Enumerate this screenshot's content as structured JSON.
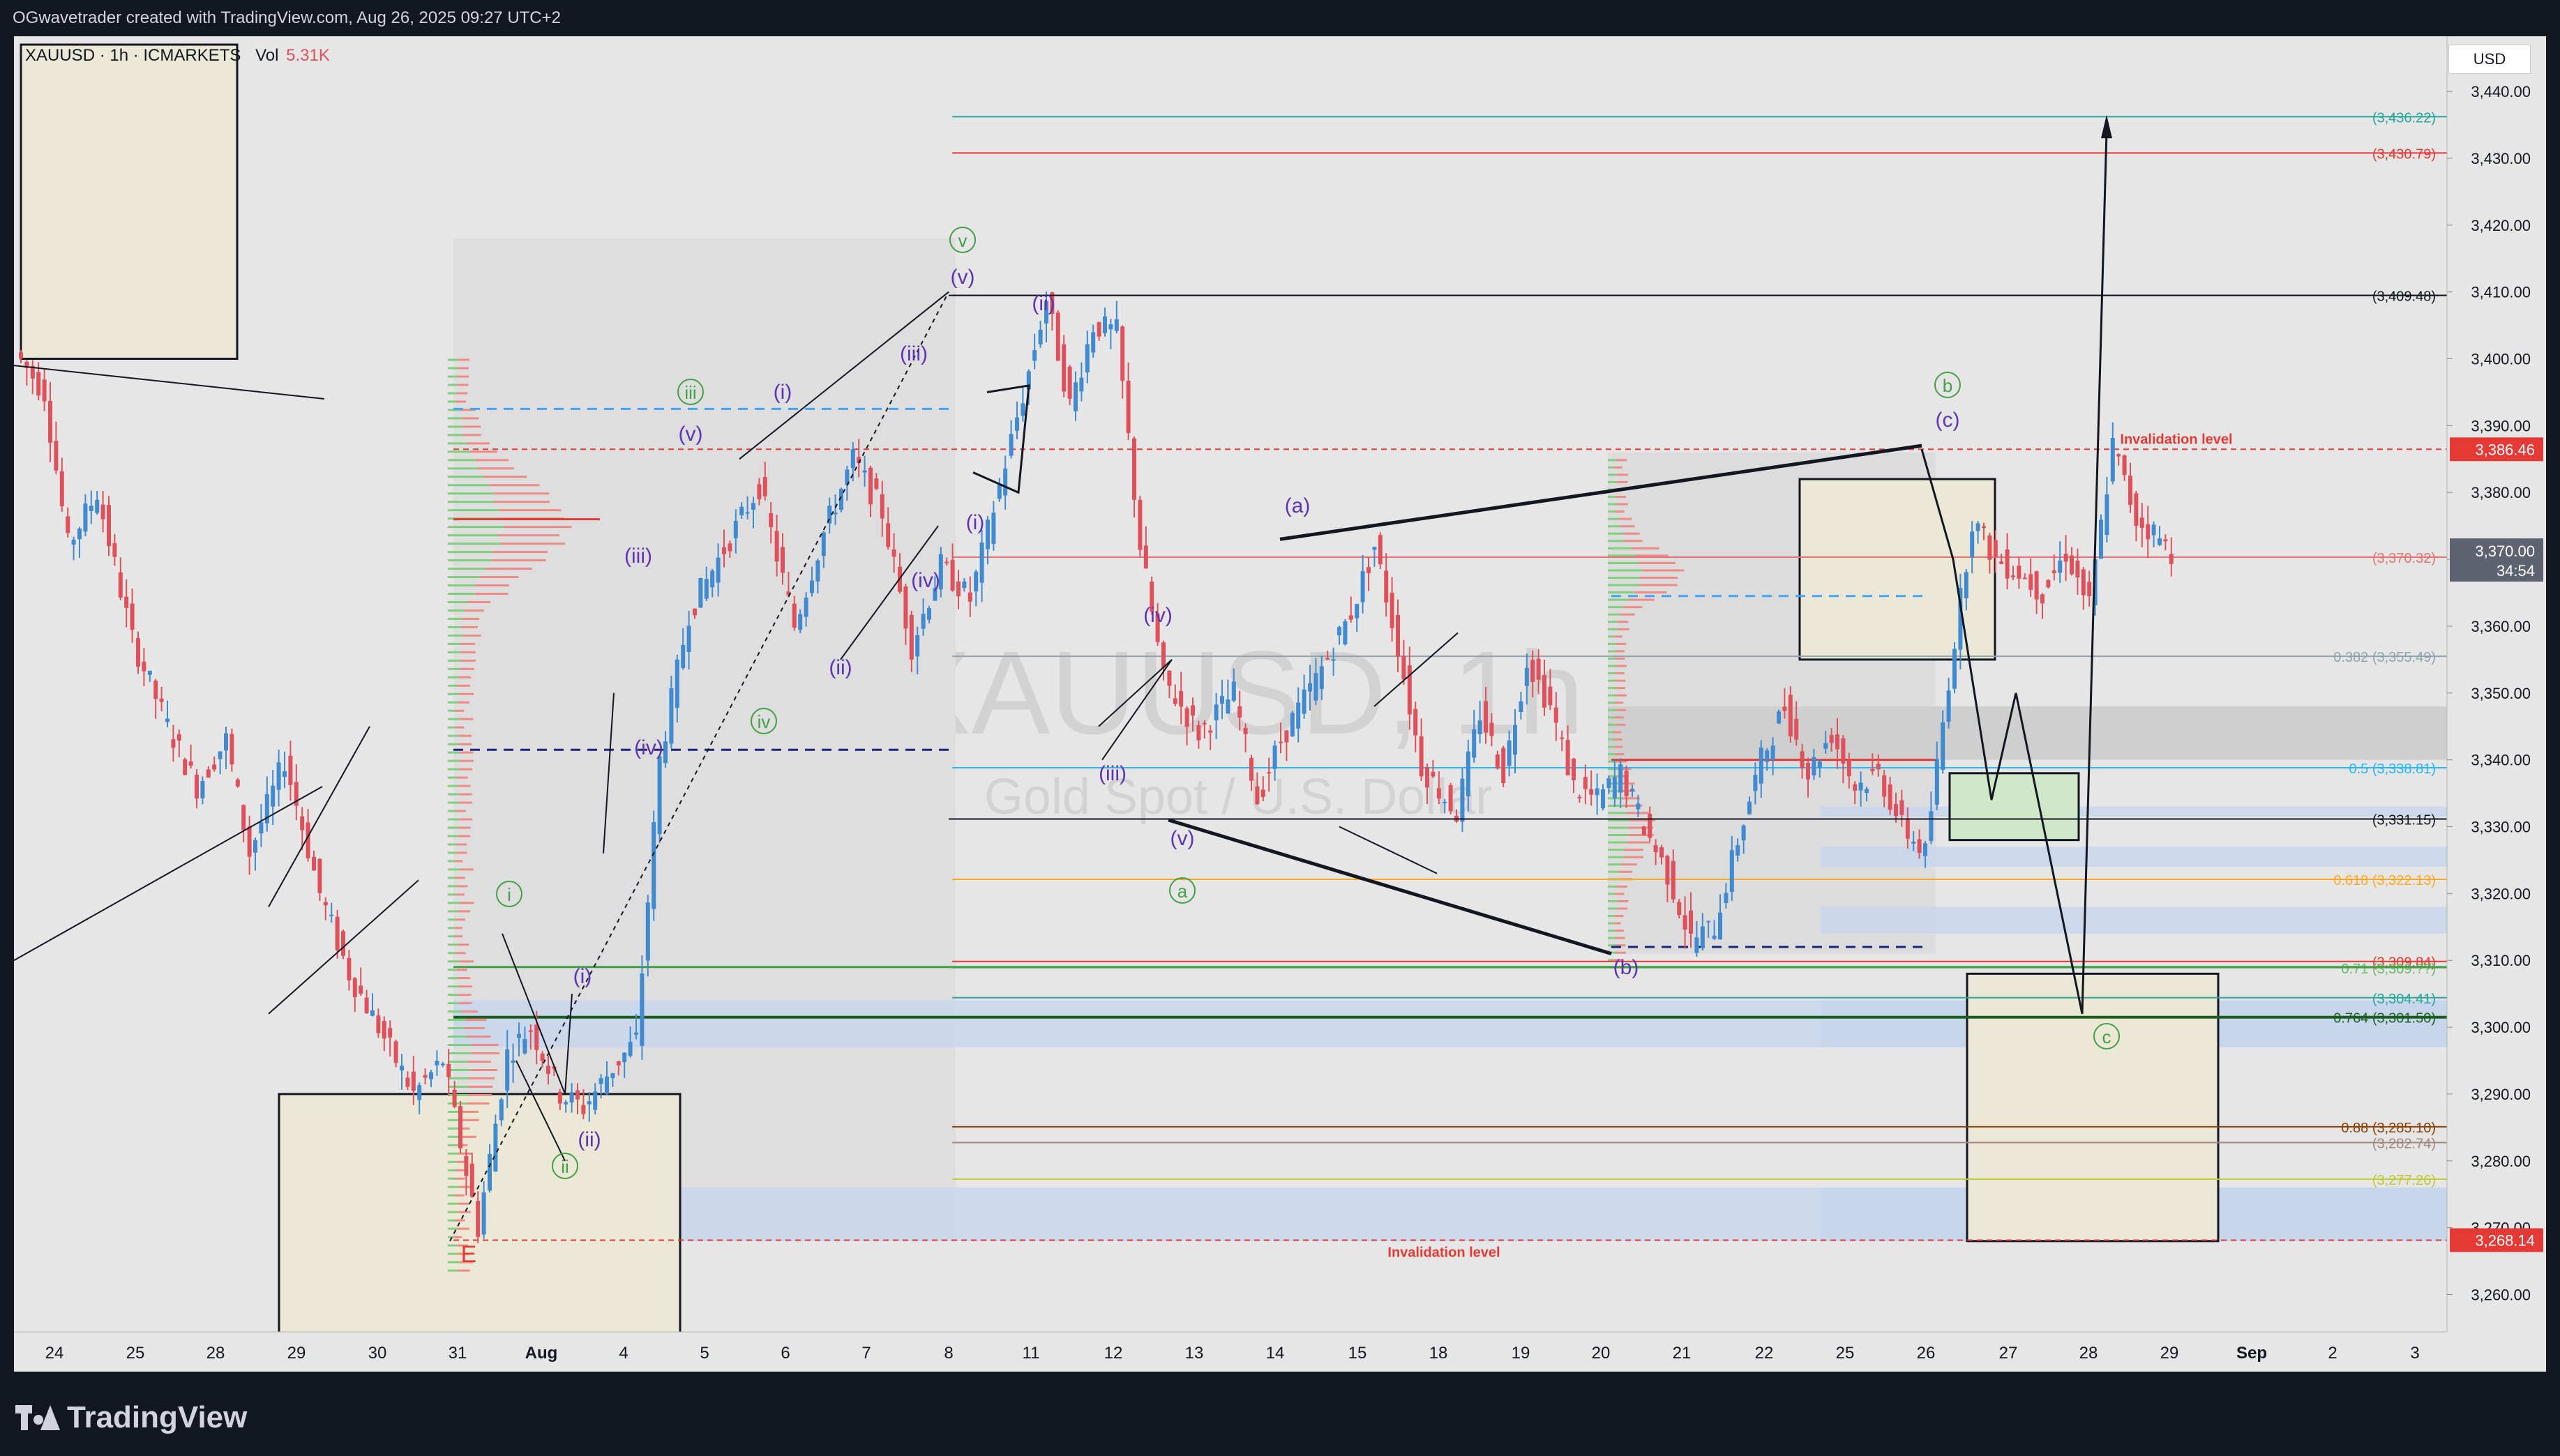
{
  "caption": "OGwavetrader created with TradingView.com, Aug 26, 2025 09:27 UTC+2",
  "symbol_line": "XAUUSD · 1h · ICMARKETS",
  "vol_label": "Vol",
  "vol_value": "5.31K",
  "currency": "USD",
  "watermark_symbol": "XAUUSD, 1h",
  "watermark_name": "Gold Spot / U.S. Dollar",
  "logo_text": "TradingView",
  "colors": {
    "up": "#26a69a",
    "down": "#ef5350",
    "green_label": "#43a047",
    "purple_label": "#5e35b1",
    "red_level": "#e53935",
    "blue": "#2962ff"
  },
  "chart_data": {
    "type": "candlestick",
    "title": "XAUUSD · 1h · ICMARKETS",
    "ylim": [
      3254,
      3447
    ],
    "y_ticks": [
      "3,440.00",
      "3,430.00",
      "3,420.00",
      "3,410.00",
      "3,400.00",
      "3,390.00",
      "3,380.00",
      "3,370.00",
      "3,360.00",
      "3,350.00",
      "3,340.00",
      "3,330.00",
      "3,320.00",
      "3,310.00",
      "3,300.00",
      "3,290.00",
      "3,280.00",
      "3,270.00",
      "3,260.00"
    ],
    "x_ticks": [
      "24",
      "25",
      "28",
      "29",
      "30",
      "31",
      "Aug",
      "4",
      "5",
      "6",
      "7",
      "8",
      "11",
      "12",
      "13",
      "14",
      "15",
      "18",
      "19",
      "20",
      "21",
      "22",
      "25",
      "26",
      "27",
      "28",
      "29",
      "Sep",
      "2",
      "3"
    ],
    "price_path": [
      [
        0,
        3401
      ],
      [
        5,
        3395
      ],
      [
        9,
        3372
      ],
      [
        14,
        3380
      ],
      [
        20,
        3358
      ],
      [
        26,
        3345
      ],
      [
        31,
        3336
      ],
      [
        36,
        3343
      ],
      [
        40,
        3326
      ],
      [
        46,
        3340
      ],
      [
        52,
        3320
      ],
      [
        57,
        3308
      ],
      [
        62,
        3300
      ],
      [
        68,
        3290
      ],
      [
        73,
        3295
      ],
      [
        79,
        3270
      ],
      [
        84,
        3296
      ],
      [
        88,
        3300
      ],
      [
        93,
        3290
      ],
      [
        97,
        3288
      ],
      [
        102,
        3294
      ],
      [
        106,
        3298
      ],
      [
        110,
        3340
      ],
      [
        115,
        3362
      ],
      [
        120,
        3370
      ],
      [
        127,
        3381
      ],
      [
        133,
        3360
      ],
      [
        138,
        3374
      ],
      [
        143,
        3385
      ],
      [
        148,
        3377
      ],
      [
        153,
        3357
      ],
      [
        158,
        3369
      ],
      [
        163,
        3364
      ],
      [
        168,
        3381
      ],
      [
        173,
        3398
      ],
      [
        176,
        3409
      ],
      [
        180,
        3393
      ],
      [
        184,
        3405
      ],
      [
        188,
        3404
      ],
      [
        192,
        3372
      ],
      [
        196,
        3352
      ],
      [
        202,
        3344
      ],
      [
        208,
        3350
      ],
      [
        212,
        3334
      ],
      [
        216,
        3343
      ],
      [
        222,
        3352
      ],
      [
        228,
        3362
      ],
      [
        232,
        3372
      ],
      [
        236,
        3357
      ],
      [
        240,
        3339
      ],
      [
        246,
        3332
      ],
      [
        250,
        3347
      ],
      [
        254,
        3338
      ],
      [
        258,
        3355
      ],
      [
        262,
        3348
      ],
      [
        266,
        3336
      ],
      [
        270,
        3334
      ],
      [
        274,
        3338
      ],
      [
        278,
        3330
      ],
      [
        282,
        3323
      ],
      [
        286,
        3313
      ],
      [
        290,
        3315
      ],
      [
        294,
        3328
      ],
      [
        298,
        3340
      ],
      [
        302,
        3348
      ],
      [
        306,
        3338
      ],
      [
        310,
        3344
      ],
      [
        314,
        3336
      ],
      [
        318,
        3338
      ],
      [
        322,
        3330
      ],
      [
        326,
        3326
      ],
      [
        330,
        3352
      ],
      [
        334,
        3376
      ],
      [
        338,
        3370
      ],
      [
        342,
        3368
      ],
      [
        346,
        3365
      ],
      [
        350,
        3371
      ],
      [
        354,
        3363
      ],
      [
        358,
        3387
      ],
      [
        362,
        3376
      ],
      [
        365,
        3374
      ],
      [
        368,
        3371
      ]
    ],
    "price_levels": [
      {
        "label": "(3,436.22)",
        "value": 3436.22,
        "color": "#26a69a"
      },
      {
        "label": "(3,430.79)",
        "value": 3430.79,
        "color": "#e53935"
      },
      {
        "label": "(3,409.48)",
        "value": 3409.48,
        "color": "#131722"
      },
      {
        "label": "3,386.46",
        "value": 3386.46,
        "color": "#e53935",
        "tag": true
      },
      {
        "label": "(3,370.32)",
        "value": 3370.32,
        "color": "#e57373"
      },
      {
        "label": "0.382 (3,355.49)",
        "value": 3355.49,
        "color": "#90a4ae"
      },
      {
        "label": "0.5 (3,338.81)",
        "value": 3338.81,
        "color": "#29b6f6"
      },
      {
        "label": "(3,331.15)",
        "value": 3331.15,
        "color": "#131722"
      },
      {
        "label": "0.618 (3,322.13)",
        "value": 3322.13,
        "color": "#ffa726"
      },
      {
        "label": "(3,309.84)",
        "value": 3309.84,
        "color": "#e53935"
      },
      {
        "label": "0.71 (3,309.??)",
        "value": 3308.9,
        "color": "#66bb6a"
      },
      {
        "label": "(3,304.41)",
        "value": 3304.41,
        "color": "#26a69a"
      },
      {
        "label": "0.764 (3,301.50)",
        "value": 3301.5,
        "color": "#1b5e20"
      },
      {
        "label": "0.88 (3,285.10)",
        "value": 3285.1,
        "color": "#8d4004"
      },
      {
        "label": "(3,282.74)",
        "value": 3282.74,
        "color": "#a1887f"
      },
      {
        "label": "(3,277.26)",
        "value": 3277.26,
        "color": "#c0ca33"
      },
      {
        "label": "3,268.14",
        "value": 3268.14,
        "color": "#e53935",
        "tag": true
      }
    ],
    "current_price": "3,370.00",
    "countdown": "34:54",
    "invalidation_text": "Invalidation level",
    "wave_labels": [
      "E",
      "i",
      "ii",
      "iii",
      "iv",
      "v",
      "(i)",
      "(ii)",
      "(iii)",
      "(iv)",
      "(v)",
      "(a)",
      "(b)",
      "(c)",
      "a",
      "b",
      "c"
    ]
  }
}
